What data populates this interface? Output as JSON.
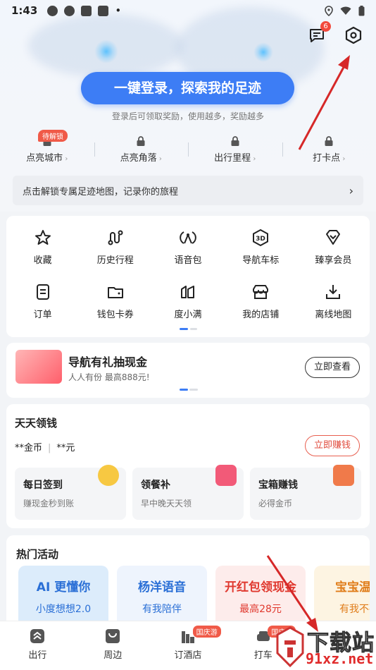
{
  "status_bar": {
    "time": "1:43",
    "dot": "•"
  },
  "header": {
    "message_badge": "6",
    "icons": [
      "message-icon",
      "settings-hexagon-icon"
    ]
  },
  "login": {
    "button_label": "一键登录，探索我的足迹",
    "subtitle": "登录后可领取奖励，使用越多，奖励越多"
  },
  "stats": {
    "unlock_tag": "待解锁",
    "items": [
      {
        "label": "点亮城市"
      },
      {
        "label": "点亮角落"
      },
      {
        "label": "出行里程"
      },
      {
        "label": "打卡点"
      }
    ]
  },
  "unlock_bar": {
    "text": "点击解锁专属足迹地图，记录你的旅程",
    "arrow": "›"
  },
  "grid": {
    "items": [
      {
        "label": "收藏",
        "icon": "star-icon"
      },
      {
        "label": "历史行程",
        "icon": "route-icon"
      },
      {
        "label": "语音包",
        "icon": "voice-icon"
      },
      {
        "label": "导航车标",
        "icon": "3d-icon"
      },
      {
        "label": "臻享会员",
        "icon": "diamond-icon"
      },
      {
        "label": "订单",
        "icon": "order-icon"
      },
      {
        "label": "钱包卡券",
        "icon": "wallet-icon"
      },
      {
        "label": "度小满",
        "icon": "duxiaoman-icon"
      },
      {
        "label": "我的店铺",
        "icon": "shop-icon"
      },
      {
        "label": "离线地图",
        "icon": "download-icon"
      }
    ]
  },
  "promo": {
    "title": "导航有礼抽现金",
    "subtitle": "人人有份 最高888元!",
    "button": "立即查看"
  },
  "earn": {
    "title": "天天领钱",
    "coins": "**金币",
    "cash": "**元",
    "button": "立即赚钱",
    "tasks": [
      {
        "title": "每日签到",
        "subtitle": "赚现金秒到账",
        "color": "#f7c842"
      },
      {
        "title": "领餐补",
        "subtitle": "早中晚天天领",
        "color": "#f25a78"
      },
      {
        "title": "宝箱赚钱",
        "subtitle": "必得金币",
        "color": "#f07a4a"
      }
    ]
  },
  "hot": {
    "title": "热门活动",
    "cards": [
      {
        "title": "AI 更懂你",
        "subtitle": "小度想想2.0",
        "bg": "#dcecfb",
        "color": "#2a6fd6"
      },
      {
        "title": "杨洋语音",
        "subtitle": "有我陪伴",
        "bg": "#eef4fd",
        "color": "#2a6fd6"
      },
      {
        "title": "开红包领现金",
        "subtitle": "最高28元",
        "bg": "#fdeceb",
        "color": "#e0392f"
      },
      {
        "title": "宝宝温柔",
        "subtitle": "有我不孤",
        "bg": "#fdf4e2",
        "color": "#e07d1a"
      }
    ]
  },
  "tabbar": {
    "items": [
      {
        "label": "出行"
      },
      {
        "label": "周边"
      },
      {
        "label": "订酒店",
        "badge": "国庆游"
      },
      {
        "label": "打车",
        "badge": "国庆礼"
      }
    ]
  },
  "watermark": {
    "line1": "下载站",
    "line2": "91xz.net"
  },
  "colors": {
    "accent": "#3d7df5",
    "red": "#f05a48",
    "annotation_arrow": "#d62828"
  }
}
